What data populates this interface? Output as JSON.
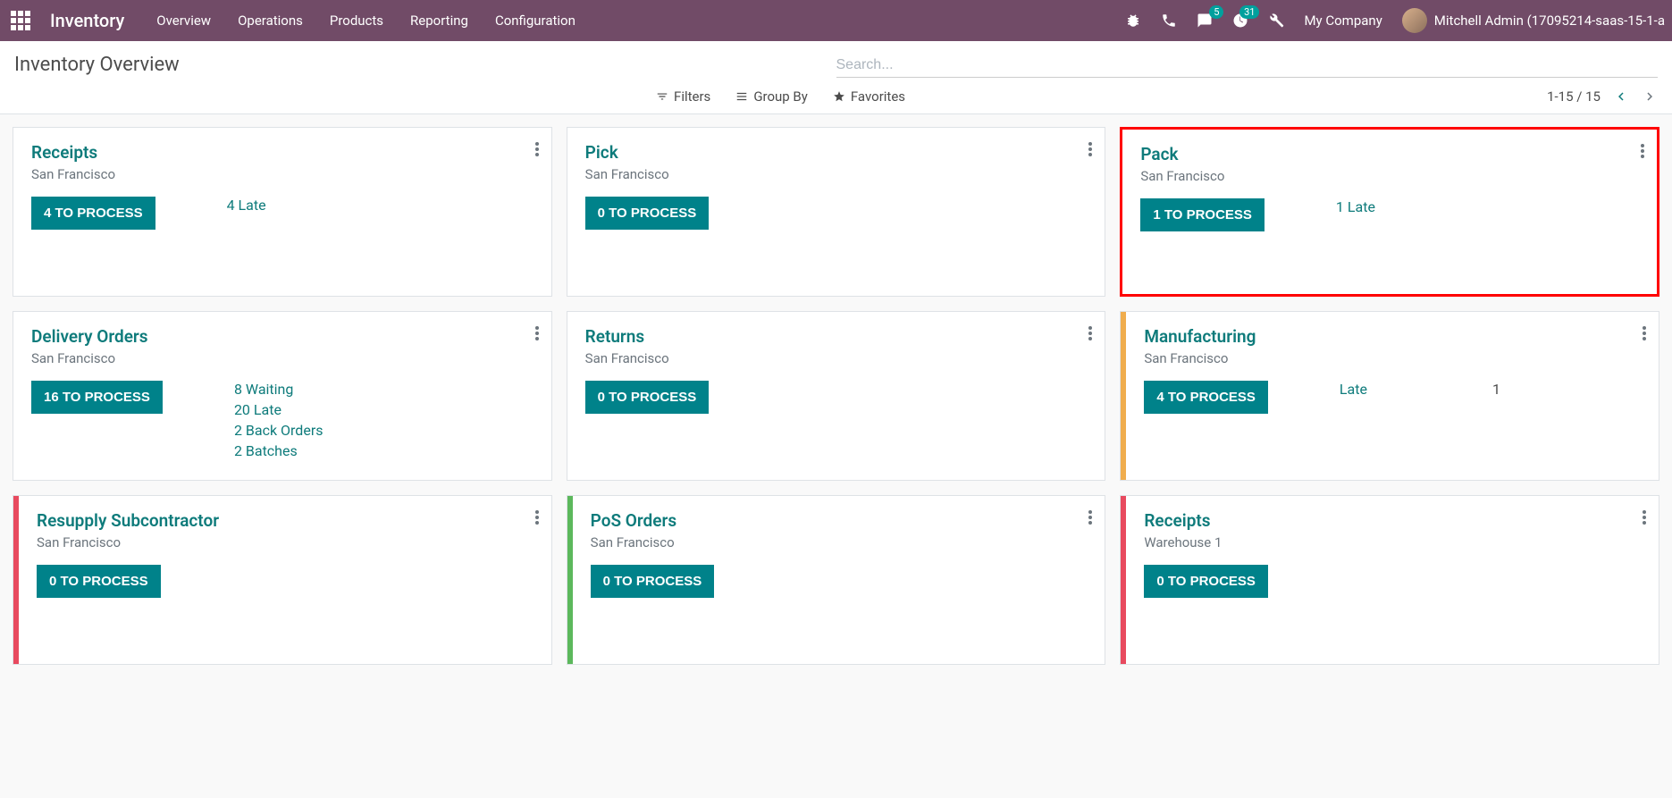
{
  "navbar": {
    "brand": "Inventory",
    "menu": [
      "Overview",
      "Operations",
      "Products",
      "Reporting",
      "Configuration"
    ],
    "chat_badge": "5",
    "activity_badge": "31",
    "company": "My Company",
    "user": "Mitchell Admin (17095214-saas-15-1-a"
  },
  "control_panel": {
    "title": "Inventory Overview",
    "search_placeholder": "Search...",
    "filters_label": "Filters",
    "groupby_label": "Group By",
    "favorites_label": "Favorites",
    "pager": "1-15 / 15"
  },
  "cards": [
    {
      "title": "Receipts",
      "subtitle": "San Francisco",
      "process": "4 TO PROCESS",
      "stats": [
        "4 Late"
      ],
      "bar": null,
      "highlighted": false
    },
    {
      "title": "Pick",
      "subtitle": "San Francisco",
      "process": "0 TO PROCESS",
      "stats": [],
      "bar": null,
      "highlighted": false
    },
    {
      "title": "Pack",
      "subtitle": "San Francisco",
      "process": "1 TO PROCESS",
      "stats": [
        "1 Late"
      ],
      "bar": null,
      "highlighted": true
    },
    {
      "title": "Delivery Orders",
      "subtitle": "San Francisco",
      "process": "16 TO PROCESS",
      "stats": [
        "8 Waiting",
        "20 Late",
        "2 Back Orders",
        "2 Batches"
      ],
      "bar": null,
      "highlighted": false
    },
    {
      "title": "Returns",
      "subtitle": "San Francisco",
      "process": "0 TO PROCESS",
      "stats": [],
      "bar": null,
      "highlighted": false
    },
    {
      "title": "Manufacturing",
      "subtitle": "San Francisco",
      "process": "4 TO PROCESS",
      "stat_row": {
        "label": "Late",
        "value": "1"
      },
      "bar": "orange",
      "highlighted": false
    },
    {
      "title": "Resupply Subcontractor",
      "subtitle": "San Francisco",
      "process": "0 TO PROCESS",
      "stats": [],
      "bar": "red",
      "highlighted": false
    },
    {
      "title": "PoS Orders",
      "subtitle": "San Francisco",
      "process": "0 TO PROCESS",
      "stats": [],
      "bar": "green",
      "highlighted": false
    },
    {
      "title": "Receipts",
      "subtitle": "Warehouse 1",
      "process": "0 TO PROCESS",
      "stats": [],
      "bar": "red",
      "highlighted": false
    }
  ]
}
